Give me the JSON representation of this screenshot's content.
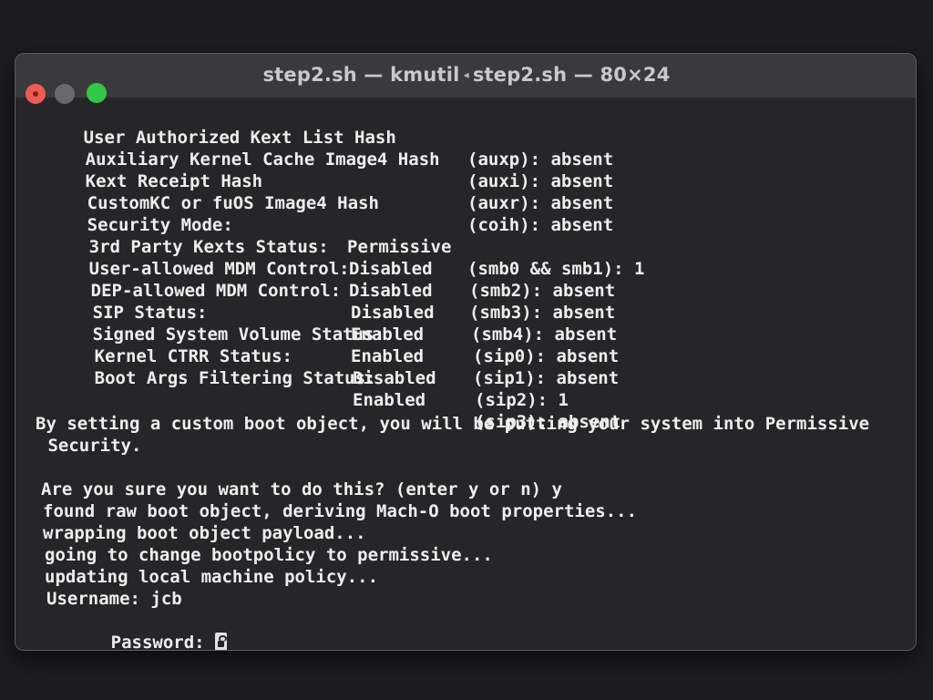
{
  "window": {
    "title_left": "step2.sh — kmutil",
    "title_sep": "◂",
    "title_right": "step2.sh — 80×24"
  },
  "security_table": [
    {
      "label": "User Authorized Kext List Hash",
      "value": "",
      "key": "(auxp): absent"
    },
    {
      "label": "Auxiliary Kernel Cache Image4 Hash",
      "value": "",
      "key": "(auxi): absent"
    },
    {
      "label": "Kext Receipt Hash",
      "value": "",
      "key": "(auxr): absent"
    },
    {
      "label": "CustomKC or fuOS Image4 Hash",
      "value": "",
      "key": "(coih): absent"
    },
    {
      "label": "Security Mode:",
      "value": "Permissive",
      "key": "(smb0 && smb1): 1"
    },
    {
      "label": "3rd Party Kexts Status:",
      "value": "Disabled",
      "key": "(smb2): absent"
    },
    {
      "label": "User-allowed MDM Control:",
      "value": "Disabled",
      "key": "(smb3): absent"
    },
    {
      "label": "DEP-allowed MDM Control:",
      "value": "Disabled",
      "key": "(smb4): absent"
    },
    {
      "label": "SIP Status:",
      "value": "Enabled",
      "key": "(sip0): absent"
    },
    {
      "label": "Signed System Volume Status:",
      "value": "Enabled",
      "key": "(sip1): absent"
    },
    {
      "label": "Kernel CTRR Status:",
      "value": "Disabled",
      "key": "(sip2): 1"
    },
    {
      "label": "Boot Args Filtering Status:",
      "value": "Enabled",
      "key": "(sip3): absent"
    }
  ],
  "messages": {
    "warning_1": "By setting a custom boot object, you will be putting your system into Permissive",
    "warning_2": " Security.",
    "prompt": "Are you sure you want to do this? (enter y or n) y",
    "log_1": "found raw boot object, deriving Mach-O boot properties...",
    "log_2": "wrapping boot object payload...",
    "log_3": "going to change bootpolicy to permissive...",
    "log_4": "updating local machine policy...",
    "username": "Username: jcb",
    "password": "Password: "
  },
  "icons": {
    "password_cursor": "key-icon"
  }
}
